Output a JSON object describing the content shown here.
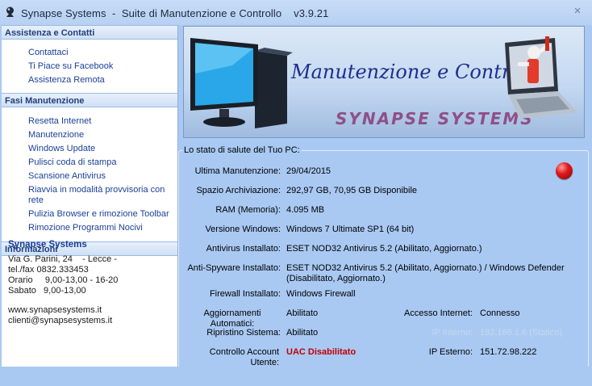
{
  "window": {
    "title": "Synapse Systems  -  Suite di Manutenzione e Controllo    v3.9.21",
    "close_symbol": "×"
  },
  "sidebar": {
    "assistenza": {
      "header": "Assistenza e Contatti",
      "items": [
        "Contattaci",
        "Ti Piace su Facebook",
        "Assistenza Remota"
      ]
    },
    "fasi": {
      "header": "Fasi Manutenzione",
      "items": [
        "Resetta Internet",
        "Manutenzione",
        "Windows Update",
        "Pulisci coda di stampa",
        "Scansione Antivirus",
        "Riavvia in modalità provvisoria con rete",
        "Pulizia Browser e rimozione Toolbar",
        "Rimozione Programmi Nocivi"
      ]
    },
    "informazioni": {
      "header": "Informazioni",
      "company": "Synapse Systems",
      "lines": [
        "Via G. Parini, 24    - Lecce -",
        "tel./fax 0832.333453",
        "Orario     9,00-13,00 - 16-20",
        "Sabato   9,00-13,00"
      ],
      "website": "www.synapsesystems.it",
      "email": "clienti@synapsesystems.it"
    }
  },
  "banner": {
    "title": "Manutenzione e Controllo",
    "brand": "SYNAPSE SYSTEMS"
  },
  "status": {
    "legend": "Lo stato di salute del Tuo PC:",
    "ultima_manutenzione": {
      "label": "Ultima Manutenzione:",
      "value": "29/04/2015"
    },
    "spazio": {
      "label": "Spazio Archiviazione:",
      "value": "292,97 GB, 70,95 GB Disponibile"
    },
    "ram": {
      "label": "RAM (Memoria):",
      "value": "4.095 MB"
    },
    "windows": {
      "label": "Versione Windows:",
      "value": "Windows 7 Ultimate  SP1 (64 bit)"
    },
    "antivirus": {
      "label": "Antivirus Installato:",
      "value": "ESET NOD32 Antivirus 5.2 (Abilitato, Aggiornato.)"
    },
    "antispyware": {
      "label": "Anti-Spyware Installato:",
      "value_line1": "ESET NOD32 Antivirus 5.2 (Abilitato, Aggiornato.)  /  Windows Defender",
      "value_line2": "(Disabilitato, Aggiornato.)"
    },
    "firewall": {
      "label": "Firewall Installato:",
      "value": "Windows Firewall"
    },
    "aggiornamenti": {
      "label_line1": "Aggiornamenti",
      "label_line2": "Automatici:",
      "value": "Abilitato"
    },
    "accesso_internet": {
      "label": "Accesso Internet:",
      "value": "Connesso"
    },
    "ripristino": {
      "label": "Ripristino Sistema:",
      "value": "Abilitato"
    },
    "ip_interno": {
      "label": "IP Interno:",
      "value": "192.168.1.6 (Statico)"
    },
    "uac": {
      "label_line1": "Controllo Account",
      "label_line2": "Utente:",
      "value": "UAC Disabilitato"
    },
    "ip_esterno": {
      "label": "IP Esterno:",
      "value": "151.72.98.222"
    }
  },
  "colors": {
    "background": "#a9c9f3",
    "link": "#1b3f96",
    "uac_warning": "#c00000",
    "status_light": "#e01b1b"
  }
}
